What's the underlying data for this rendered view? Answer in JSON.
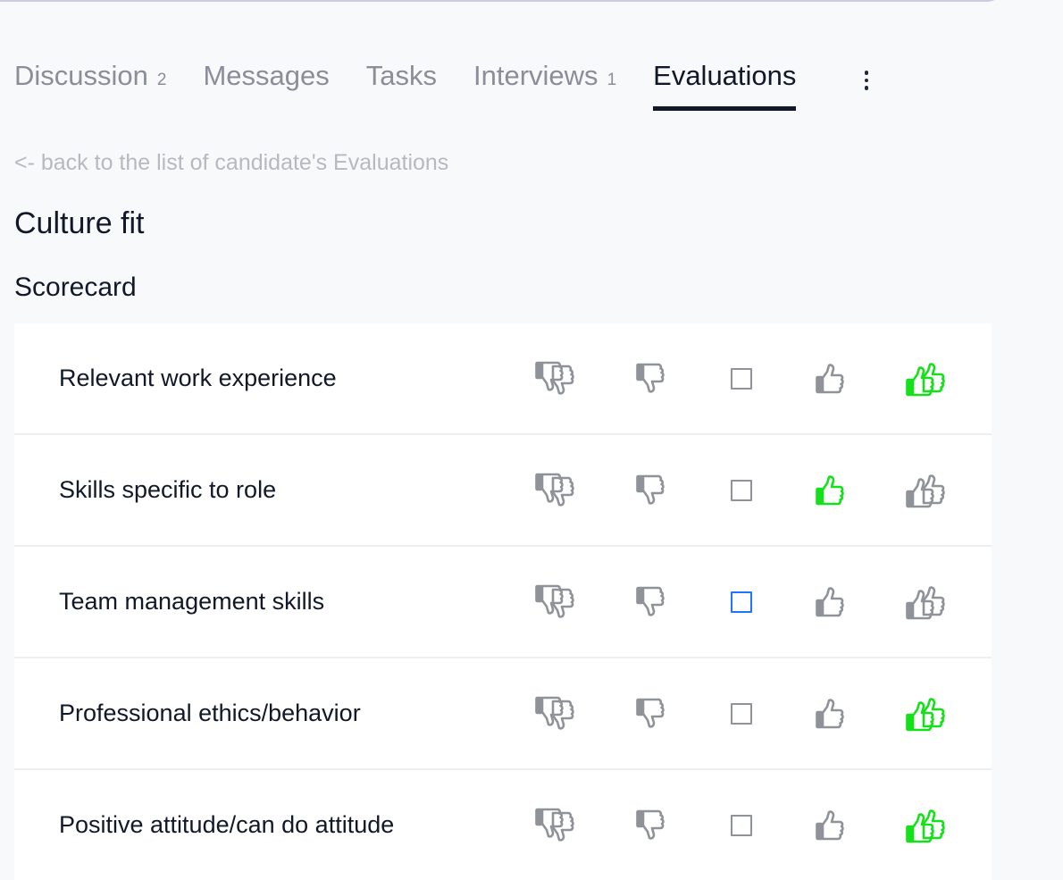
{
  "tabs": [
    {
      "label": "Discussion",
      "count": "2",
      "active": false
    },
    {
      "label": "Messages",
      "count": "",
      "active": false
    },
    {
      "label": "Tasks",
      "count": "",
      "active": false
    },
    {
      "label": "Interviews",
      "count": "1",
      "active": false
    },
    {
      "label": "Evaluations",
      "count": "",
      "active": true
    }
  ],
  "back_link": "<- back to the list of candidate's Evaluations",
  "title": "Culture fit",
  "section_title": "Scorecard",
  "rating_scale": [
    "strong-no",
    "no",
    "neutral",
    "yes",
    "strong-yes"
  ],
  "criteria": [
    {
      "name": "Relevant work experience",
      "rating": "strong-yes"
    },
    {
      "name": "Skills specific to role",
      "rating": "yes"
    },
    {
      "name": "Team management skills",
      "rating": "neutral"
    },
    {
      "name": "Professional ethics/behavior",
      "rating": "strong-yes"
    },
    {
      "name": "Positive attitude/can do attitude",
      "rating": "strong-yes"
    }
  ],
  "colors": {
    "selected_green": "#16e01a",
    "selected_blue": "#1e74ff",
    "icon_gray": "#8f9399",
    "tab_inactive": "#8a8e99",
    "text_dark": "#111827"
  }
}
